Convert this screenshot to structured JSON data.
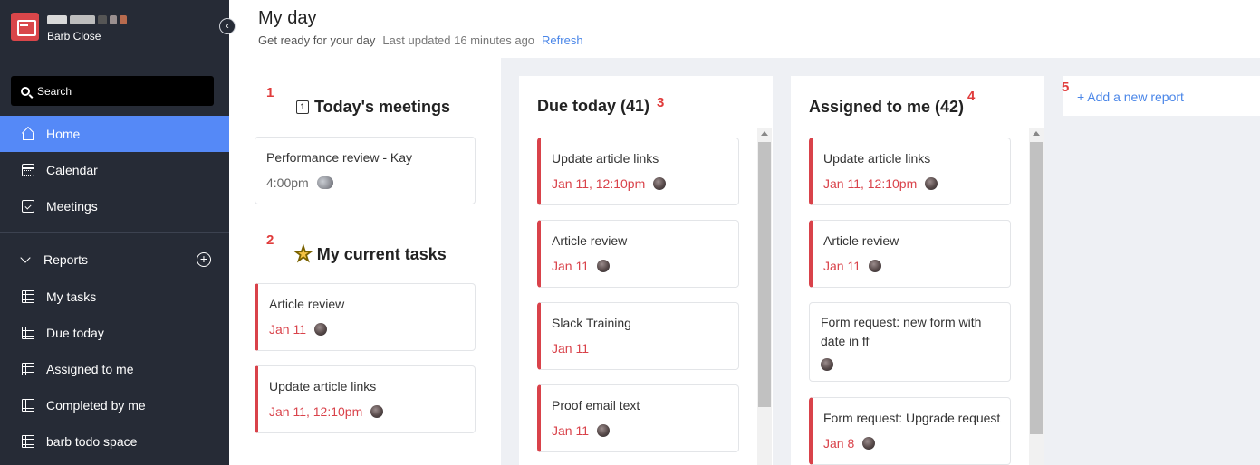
{
  "app": {
    "user_name": "Barb Close",
    "brand_colors": [
      "#d9d9d9",
      "#ffffff",
      "#cfcfcf",
      "#555555",
      "#9a8f8f",
      "#b86b4e"
    ]
  },
  "sidebar": {
    "search_label": "Search",
    "nav": [
      {
        "label": "Home",
        "icon": "home-icon",
        "active": true
      },
      {
        "label": "Calendar",
        "icon": "calendar-icon"
      },
      {
        "label": "Meetings",
        "icon": "meetings-icon"
      }
    ],
    "reports_label": "Reports",
    "reports": [
      {
        "label": "My tasks",
        "icon": "table-icon"
      },
      {
        "label": "Due today",
        "icon": "table-icon"
      },
      {
        "label": "Assigned to me",
        "icon": "table-icon"
      },
      {
        "label": "Completed by me",
        "icon": "table-icon"
      },
      {
        "label": "barb todo space",
        "icon": "table-icon"
      }
    ]
  },
  "header": {
    "title": "My day",
    "subtitle": "Get ready for your day",
    "updated": "Last updated 16 minutes ago",
    "refresh": "Refresh"
  },
  "overview": {
    "marker_meetings": "1",
    "meetings_title": "Today's meetings",
    "meetings_icon_glyph": "1",
    "meetings": [
      {
        "title": "Performance review - Kay",
        "time": "4:00pm"
      }
    ],
    "marker_tasks": "2",
    "tasks_title": "My current tasks",
    "star_glyph": "★",
    "tasks": [
      {
        "title": "Article review",
        "due": "Jan 11"
      },
      {
        "title": "Update article links",
        "due": "Jan 11, 12:10pm"
      }
    ]
  },
  "due_today": {
    "marker": "3",
    "title": "Due today (41)",
    "cards": [
      {
        "title": "Update article links",
        "due": "Jan 11, 12:10pm"
      },
      {
        "title": "Article review",
        "due": "Jan 11"
      },
      {
        "title": "Slack Training",
        "due": "Jan 11"
      },
      {
        "title": "Proof email text",
        "due": "Jan 11"
      }
    ]
  },
  "assigned": {
    "marker": "4",
    "title": "Assigned to me (42)",
    "cards": [
      {
        "title": "Update article links",
        "due": "Jan 11, 12:10pm"
      },
      {
        "title": "Article review",
        "due": "Jan 11"
      },
      {
        "title": "Form request: new form with",
        "title2": "date in ff"
      },
      {
        "title": "Form request: Upgrade request",
        "due": "Jan 8"
      }
    ]
  },
  "add_report": {
    "marker": "5",
    "label": "+ Add a new report"
  }
}
